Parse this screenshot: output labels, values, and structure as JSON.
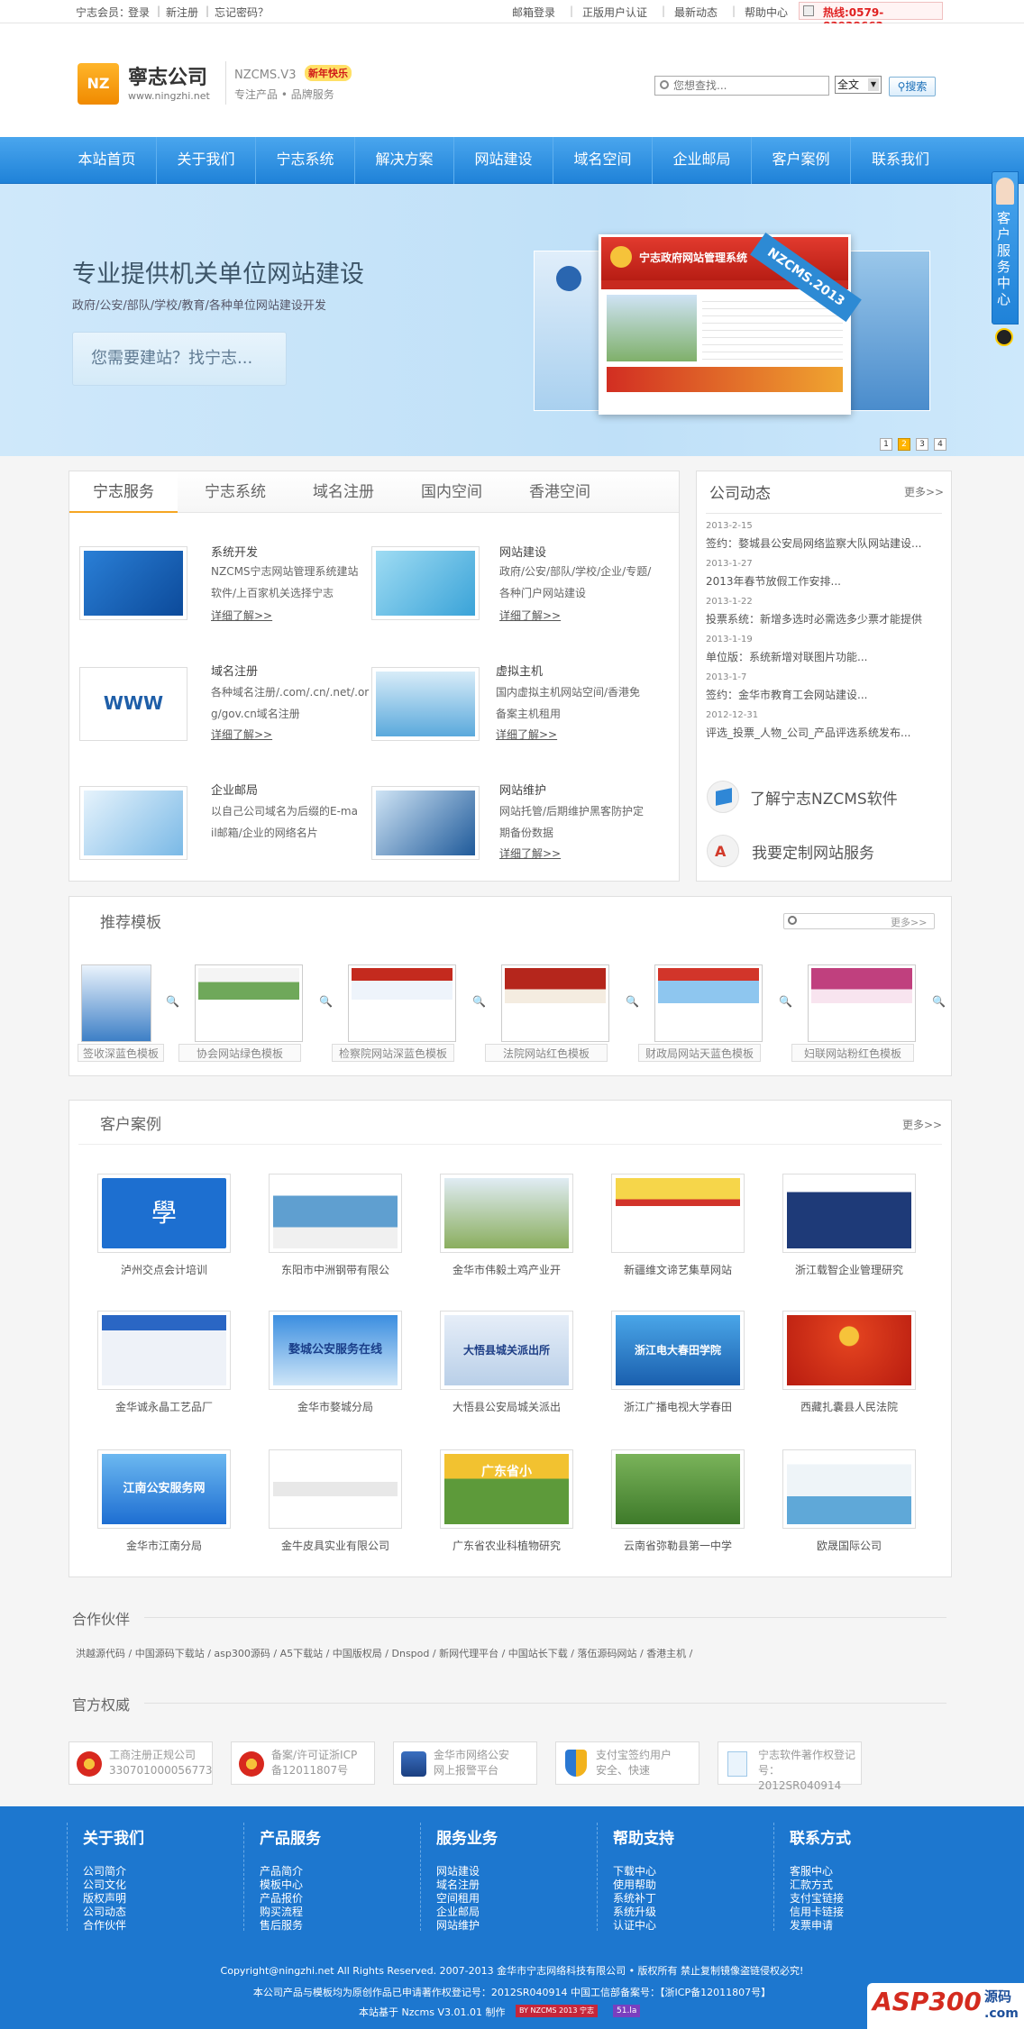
{
  "topbar": {
    "member": "宁志会员：",
    "login": "登录",
    "sep1": "|",
    "register": "新注册",
    "sep2": "|",
    "forgot": "忘记密码？",
    "links": [
      "邮箱登录",
      "正版用户认证",
      "最新动态",
      "帮助中心"
    ],
    "hotline": "热线:0579-83938663"
  },
  "header": {
    "logo_mark": "NZ",
    "logo_name": "寧志公司",
    "logo_url": "www.ningzhi.net",
    "product": "NZCMS.V3",
    "badge": "新年快乐",
    "slogan": "专注产品 • 品牌服务",
    "search_placeholder": "您想查找...",
    "search_scope": "全文",
    "search_button": "搜索"
  },
  "nav": [
    "本站首页",
    "关于我们",
    "宁志系统",
    "解决方案",
    "网站建设",
    "域名空间",
    "企业邮局",
    "客户案例",
    "联系我们"
  ],
  "banner": {
    "title": "专业提供机关单位网站建设",
    "subtitle": "政府/公安/部队/学校/教育/各种单位网站建设开发",
    "cta": "您需要建站？找宁志...",
    "screen_title": "宁志政府网站管理系统",
    "ribbon": "NZCMS.2013",
    "dots": [
      "1",
      "2",
      "3",
      "4"
    ],
    "active_dot": 1
  },
  "side_service": {
    "label": "客户服务中心"
  },
  "services": {
    "tabs": [
      "宁志服务",
      "宁志系统",
      "域名注册",
      "国内空间",
      "香港空间"
    ],
    "active_tab": 0,
    "items": [
      {
        "title": "系统开发",
        "lines": [
          "NZCMS宁志网站管理系统建站",
          "软件/上百家机关选择宁志"
        ],
        "more": "详细了解>>"
      },
      {
        "title": "网站建设",
        "lines": [
          "政府/公安/部队/学校/企业/专题/",
          "各种门户网站建设"
        ],
        "more": "详细了解>>"
      },
      {
        "title": "域名注册",
        "lines": [
          "各种域名注册/.com/.cn/.net/.or",
          "g/gov.cn域名注册"
        ],
        "more": "详细了解>>"
      },
      {
        "title": "虚拟主机",
        "lines": [
          "国内虚拟主机网站空间/香港免",
          "备案主机租用"
        ],
        "more": "详细了解>>"
      },
      {
        "title": "企业邮局",
        "lines": [
          "以自己公司域名为后缀的E-ma",
          "il邮箱/企业的网络名片"
        ],
        "more": "详细了解>>"
      },
      {
        "title": "网站维护",
        "lines": [
          "网站托管/后期维护黑客防护定",
          "期备份数据"
        ],
        "more": "详细了解>>"
      }
    ]
  },
  "news": {
    "title": "公司动态",
    "more": "更多>>",
    "items": [
      {
        "date": "2013-2-15",
        "title": "签约：婺城县公安局网络监察大队网站建设..."
      },
      {
        "date": "2013-1-27",
        "title": "2013年春节放假工作安排..."
      },
      {
        "date": "2013-1-22",
        "title": "投票系统：新增多选时必需选多少票才能提供..."
      },
      {
        "date": "2013-1-19",
        "title": "单位版：系统新增对联图片功能..."
      },
      {
        "date": "2013-1-7",
        "title": "签约：金华市教育工会网站建设..."
      },
      {
        "date": "2012-12-31",
        "title": "评选_投票_人物_公司_产品评选系统发布..."
      }
    ],
    "links": [
      "了解宁志NZCMS软件",
      "我要定制网站服务"
    ]
  },
  "templates": {
    "title": "推荐模板",
    "more": "更多>>",
    "items": [
      "签收深蓝色模板",
      "协会网站绿色模板",
      "检察院网站深蓝色模板",
      "法院网站红色模板",
      "财政局网站天蓝色模板",
      "妇联网站粉红色模板"
    ]
  },
  "cases": {
    "title": "客户案例",
    "more": "更多>>",
    "items": [
      "泸州交点会计培训",
      "东阳市中洲钢带有限公",
      "金华市伟毅土鸡产业开",
      "新疆维文谛艺集草网站",
      "浙江载智企业管理研究",
      "金华诚永晶工艺品厂",
      "金华市婺城分局",
      "大悟县公安局城关派出",
      "浙江广播电视大学春田",
      "西藏扎囊县人民法院",
      "金华市江南分局",
      "金牛皮具实业有限公司",
      "广东省农业科植物研究",
      "云南省弥勒县第一中学",
      "欧晟国际公司"
    ],
    "thumb_texts": [
      "學",
      "",
      "",
      "",
      "",
      "",
      "婺城公安服务在线",
      "大悟县城关派出所",
      "浙江电大春田学院",
      "",
      "江南公安服务网",
      "",
      "广东省小",
      "",
      ""
    ]
  },
  "partners": {
    "title": "合作伙伴",
    "links": [
      "洪越源代码",
      "中国源码下载站",
      "asp300源码",
      "A5下载站",
      "中国版权局",
      "Dnspod",
      "新网代理平台",
      "中国站长下载",
      "落伍源码网站",
      "香港主机"
    ]
  },
  "authority": {
    "title": "官方权威",
    "items": [
      {
        "l1": "工商注册正规公司",
        "l2": "330701000056773"
      },
      {
        "l1": "备案/许可证浙ICP",
        "l2": "备12011807号"
      },
      {
        "l1": "金华市网络公安",
        "l2": "网上报警平台"
      },
      {
        "l1": "支付宝签约用户",
        "l2": "安全、快速"
      },
      {
        "l1": "宁志软件著作权登记",
        "l2": "号：2012SR040914"
      }
    ]
  },
  "footer": {
    "cols": [
      {
        "title": "关于我们",
        "links": [
          "公司简介",
          "公司文化",
          "版权声明",
          "公司动态",
          "合作伙伴"
        ]
      },
      {
        "title": "产品服务",
        "links": [
          "产品简介",
          "模板中心",
          "产品报价",
          "购买流程",
          "售后服务"
        ]
      },
      {
        "title": "服务业务",
        "links": [
          "网站建设",
          "域名注册",
          "空间租用",
          "企业邮局",
          "网站维护"
        ]
      },
      {
        "title": "帮助支持",
        "links": [
          "下载中心",
          "使用帮助",
          "系统补丁",
          "系统升级",
          "认证中心"
        ]
      },
      {
        "title": "联系方式",
        "links": [
          "客服中心",
          "汇款方式",
          "支付宝链接",
          "信用卡链接",
          "发票申请"
        ]
      }
    ],
    "copyright": "Copyright@ningzhi.net All Rights Reserved. 2007-2013 金华市宁志网络科技有限公司 • 版权所有 禁止复制镜像盗链侵权必究!",
    "license": "本公司产品与模板均为原创作品已申请著作权登记号：2012SR040914   中国工信部备案号：【浙ICP备12011807号】",
    "powered": "本站基于 Nzcms V3.01.01 制作",
    "badge1": "BY NZCMS 2013 宁志",
    "badge2": "51.la",
    "watermark": "ASP300",
    "watermark2": "源码",
    "watermark_url": ".com"
  }
}
